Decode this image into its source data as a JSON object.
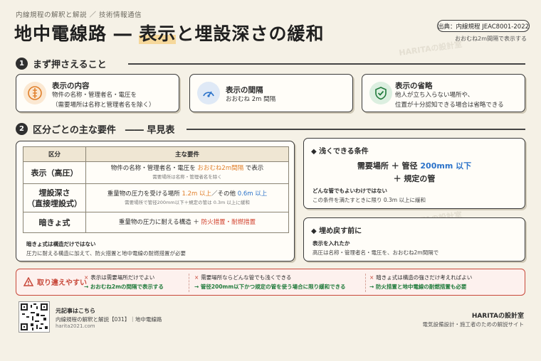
{
  "header": {
    "series": "内線規程の解釈と解説 ／ 技術情報通信",
    "title_prefix": "地中電線路 ― ",
    "title_highlight": "表示",
    "title_suffix": "と埋設深さの緩和",
    "source": "出典：内線規程 JEAC8001-2022",
    "source_note": "おおむね2m間隔で表示する",
    "watermark": "HARITAの設計室"
  },
  "section1": {
    "num": "1",
    "title": "まず押さえること",
    "cards": [
      {
        "title": "表示の内容",
        "body1": "物件の名称・管理者名・電圧を",
        "body2": "（需要場所は名称と管理者名を除く）"
      },
      {
        "title": "表示の間隔",
        "body1": "おおむね 2m 間隔",
        "body2": ""
      },
      {
        "title": "表示の省略",
        "body1": "他人が立ち入らない場所や、",
        "body2": "位置が十分認知できる場合は省略できる"
      }
    ]
  },
  "section2": {
    "num": "2",
    "title": "区分ごとの主な要件",
    "title_tail": "―― 早見表"
  },
  "table": {
    "headers": [
      "区分",
      "主な要件"
    ],
    "row1": {
      "k": "表示（高圧）",
      "v_a": "物件の名称・管理者名・電圧を ",
      "v_hl": "おおむね2m間隔",
      "v_b": " で表示",
      "sub": "需要場所は名称・管理者名を除く"
    },
    "row2": {
      "k1": "埋設深さ",
      "k2": "（直接埋設式）",
      "v_a": "重量物の圧力を受ける場所 ",
      "v_hl1": "1.2m 以上",
      "v_b": "／その他 ",
      "v_hl2": "0.6m 以上",
      "sub": "需要場所で管径200mm以下＋規定の管は 0.3m 以上に緩和"
    },
    "row3": {
      "k": "暗きょ式",
      "v_a": "重量物の圧力に耐える構造 ＋ ",
      "v_hl": "防火措置・耐燃措置"
    },
    "note_h": "暗きょ式は構造だけではない",
    "note": "圧力に耐える構造に加えて、防火措置と地中電線の耐燃措置が必要"
  },
  "shallow": {
    "title": "浅くできる条件",
    "line1_a": "需要場所 ＋ 管径 ",
    "line1_hl": "200mm 以下",
    "line2": "＋ 規定の管",
    "sub_h": "どんな管でもよいわけではない",
    "sub_t": "この条件を満たすときに限り 0.3m 以上に緩和"
  },
  "backfill": {
    "title": "埋め戻す前に",
    "sub_h": "表示を入れたか",
    "sub_t": "高圧は名称・管理者名・電圧を、おおむね2m間隔で"
  },
  "mistakes": {
    "title": "取り違えやすい",
    "items": [
      {
        "wrong": "表示は需要場所だけでよい",
        "fix": "→ おおむね2mの間隔で表示する"
      },
      {
        "wrong": "需要場所ならどんな管でも浅くできる",
        "fix": "→ 管径200mm以下かつ規定の管を使う場合に限り緩和できる"
      },
      {
        "wrong": "暗きょ式は構造の強さだけ考えればよい",
        "fix": "→ 防火措置と地中電線の耐燃措置も必要"
      }
    ]
  },
  "footer": {
    "label": "元記事はこちら",
    "article": "内線規程の解釈と解説【031】｜地中電線路",
    "url": "harita2021.com",
    "brand": "HARITAの設計室",
    "brand_sub": "電気設備設計・施工者のための解説サイト"
  },
  "colors": {
    "background": "#f5f1e6",
    "accent_orange": "#e07f2a",
    "accent_blue": "#2a72c9",
    "accent_red": "#c8483a",
    "accent_green": "#1f7a3a"
  },
  "icons": [
    "ruler-icon",
    "gauge-icon",
    "shield-check-icon",
    "warning-icon",
    "qr-code"
  ]
}
